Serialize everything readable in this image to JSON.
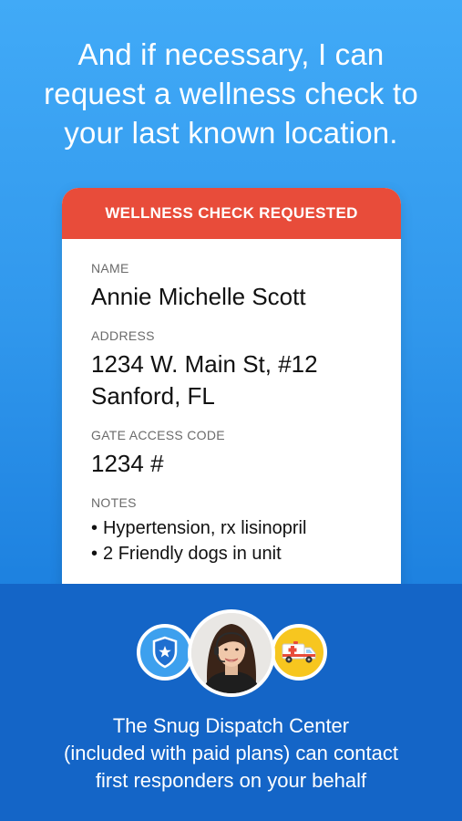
{
  "headline": {
    "line1": "And if necessary, I can",
    "line2": "request a wellness check to",
    "line3": "your last known location."
  },
  "card": {
    "header": "WELLNESS CHECK REQUESTED",
    "name_label": "NAME",
    "name_value": "Annie Michelle Scott",
    "address_label": "ADDRESS",
    "address_line1": "1234 W. Main St, #12",
    "address_line2": "Sanford, FL",
    "gate_label": "GATE ACCESS CODE",
    "gate_value": "1234 #",
    "notes_label": "NOTES",
    "notes": [
      "Hypertension, rx lisinopril",
      "2 Friendly dogs in unit"
    ]
  },
  "icons": {
    "left": "police-shield-icon",
    "center": "dispatcher-avatar",
    "right": "ambulance-icon"
  },
  "colors": {
    "header_red": "#e84c3a",
    "bottom_blue": "#1465c7",
    "shield_blue": "#3da0ee",
    "ambulance_yellow": "#f7c61f"
  },
  "caption": {
    "line1": "The Snug Dispatch Center",
    "line2": "(included with paid plans) can contact",
    "line3": "first responders on your behalf"
  }
}
